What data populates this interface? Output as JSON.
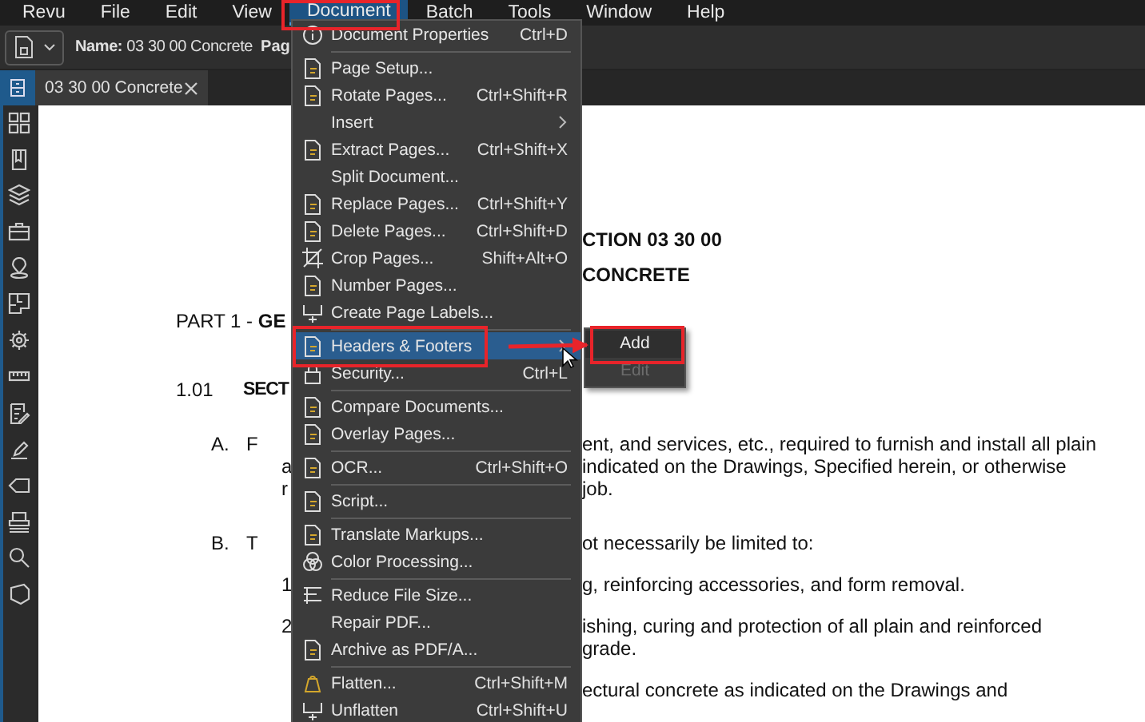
{
  "menubar": [
    {
      "label": "Revu",
      "selected": false
    },
    {
      "label": "File",
      "selected": false
    },
    {
      "label": "Edit",
      "selected": false
    },
    {
      "label": "View",
      "selected": false
    },
    {
      "label": "Document",
      "selected": true
    },
    {
      "label": "Batch",
      "selected": false
    },
    {
      "label": "Tools",
      "selected": false
    },
    {
      "label": "Window",
      "selected": false
    },
    {
      "label": "Help",
      "selected": false
    }
  ],
  "toolbar": {
    "name": "**Name:** 03 30 00 Concrete",
    "page_label": "Pag"
  },
  "tabs": [
    {
      "label": "03 30 00 Concrete",
      "selected": true
    }
  ],
  "document": {
    "rows": [
      {
        "kind": "heading",
        "text": "CTION 03 30 00"
      },
      {
        "kind": "heading",
        "text": "CONCRETE"
      },
      {
        "kind": "part",
        "label": "PART 1 -  **GE**"
      },
      {
        "kind": "article",
        "marker": "1.01",
        "title": "SECT"
      },
      {
        "kind": "para",
        "marker": "A.",
        "lead": "F",
        "text": "ent, and services, etc., required to furnish and install all plain"
      },
      {
        "kind": "cont",
        "lead": "a",
        "text": "indicated on the Drawings, Specified herein, or otherwise"
      },
      {
        "kind": "cont",
        "lead": "r",
        "text": "job."
      },
      {
        "kind": "para",
        "marker": "B.",
        "lead": "T",
        "text": "ot necessarily be limited to:"
      },
      {
        "kind": "sub",
        "lead": "1",
        "text": "g, reinforcing accessories, and form removal."
      },
      {
        "kind": "sub",
        "lead": "2",
        "text": "ishing, curing and protection of all plain and reinforced"
      },
      {
        "kind": "cont",
        "text": "grade."
      },
      {
        "kind": "sub",
        "text": "ectural concrete as indicated on the Drawings and"
      }
    ]
  },
  "menu": {
    "groups": [
      [
        {
          "label": "Document Properties",
          "shortcut": "Ctrl+D",
          "selected": false
        }
      ],
      [
        {
          "label": "Page Setup...",
          "selected": false
        },
        {
          "label": "Rotate Pages...",
          "shortcut": "Ctrl+Shift+R",
          "selected": false
        },
        {
          "label": "Insert",
          "submenu": true,
          "selected": false
        },
        {
          "label": "Extract Pages...",
          "shortcut": "Ctrl+Shift+X",
          "selected": false
        },
        {
          "label": "Split Document...",
          "selected": false
        },
        {
          "label": "Replace Pages...",
          "shortcut": "Ctrl+Shift+Y",
          "selected": false
        },
        {
          "label": "Delete Pages...",
          "shortcut": "Ctrl+Shift+D",
          "selected": false
        },
        {
          "label": "Crop Pages...",
          "shortcut": "Shift+Alt+O",
          "selected": false
        },
        {
          "label": "Number Pages...",
          "selected": false
        },
        {
          "label": "Create Page Labels...",
          "selected": false
        }
      ],
      [
        {
          "label": "Headers & Footers",
          "submenu": true,
          "selected": true
        },
        {
          "label": "Security...",
          "shortcut": "Ctrl+L",
          "selected": false
        }
      ],
      [
        {
          "label": "Compare Documents...",
          "selected": false
        },
        {
          "label": "Overlay Pages...",
          "selected": false
        }
      ],
      [
        {
          "label": "OCR...",
          "shortcut": "Ctrl+Shift+O",
          "selected": false
        }
      ],
      [
        {
          "label": "Script...",
          "selected": false
        }
      ],
      [
        {
          "label": "Translate Markups...",
          "selected": false
        },
        {
          "label": "Color Processing...",
          "selected": false
        }
      ],
      [
        {
          "label": "Reduce File Size...",
          "selected": false
        },
        {
          "label": "Repair PDF...",
          "selected": false
        },
        {
          "label": "Archive as PDF/A...",
          "selected": false
        }
      ],
      [
        {
          "label": "Flatten...",
          "shortcut": "Ctrl+Shift+M",
          "selected": false
        },
        {
          "label": "Unflatten",
          "shortcut": "Ctrl+Shift+U",
          "selected": false
        }
      ]
    ]
  },
  "submenu": {
    "items": [
      {
        "label": "Add",
        "selected": true,
        "disabled": false
      },
      {
        "label": "Edit",
        "selected": false,
        "disabled": true
      }
    ]
  }
}
